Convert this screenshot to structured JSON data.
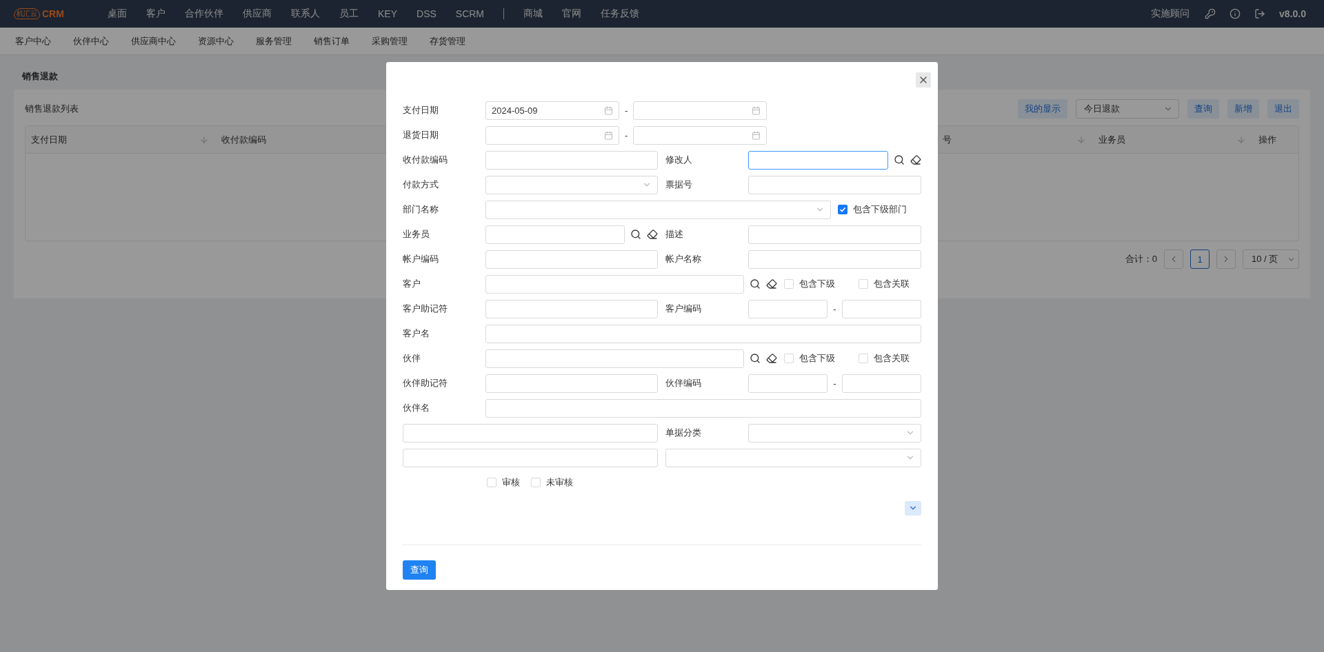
{
  "topbar": {
    "logo": {
      "badge": "机汇云",
      "name": "CRM"
    },
    "nav": [
      "桌面",
      "客户",
      "合作伙伴",
      "供应商",
      "联系人",
      "员工",
      "KEY",
      "DSS",
      "SCRM"
    ],
    "nav_extra": [
      "商城",
      "官网",
      "任务反馈"
    ],
    "role": "实施顾问",
    "version": "v8.0.0"
  },
  "subnav": [
    "客户中心",
    "伙伴中心",
    "供应商中心",
    "资源中心",
    "服务管理",
    "销售订单",
    "采购管理",
    "存货管理"
  ],
  "page": {
    "title": "销售退款",
    "card_title": "销售退款列表",
    "toolbar": {
      "display_button": "我的显示",
      "filter": "今日退款",
      "buttons": [
        "查询",
        "新增",
        "退出"
      ]
    },
    "columns": [
      {
        "label": "支付日期",
        "sortable": true
      },
      {
        "label": "收付款编码",
        "sortable": false
      },
      {
        "label": "号",
        "sortable": true
      },
      {
        "label": "业务员",
        "sortable": true
      },
      {
        "label": "操作",
        "sortable": false
      }
    ],
    "pagination": {
      "total_label": "合计：",
      "total": "0",
      "pages": [
        {
          "label": "1",
          "selected": true
        }
      ],
      "page_size": "10 / 页"
    }
  },
  "dialog": {
    "rows": [
      {
        "kind": "dates",
        "label": "支付日期",
        "value": "2024-05-09",
        "dash": "-"
      },
      {
        "kind": "dates",
        "label": "退货日期",
        "dash": "-"
      },
      {
        "kind": "pair",
        "cells": [
          {
            "label": "收付款编码",
            "kind": "text"
          },
          {
            "label": "修改人",
            "kind": "lookup",
            "focused": true
          }
        ]
      },
      {
        "kind": "pair",
        "cells": [
          {
            "label": "付款方式",
            "kind": "select"
          },
          {
            "label": "票据号",
            "kind": "text"
          }
        ]
      },
      {
        "kind": "dept",
        "label": "部门名称",
        "checkboxes": [
          {
            "label": "包含下级部门",
            "checked": true
          }
        ]
      },
      {
        "kind": "pair",
        "cells": [
          {
            "label": "业务员",
            "kind": "lookup",
            "focused": false
          },
          {
            "label": "描述",
            "kind": "text"
          }
        ]
      },
      {
        "kind": "pair",
        "cells": [
          {
            "label": "帐户编码",
            "kind": "text"
          },
          {
            "label": "帐户名称",
            "kind": "text"
          }
        ]
      },
      {
        "kind": "party",
        "label": "客户",
        "checkboxes": [
          {
            "label": "包含下级",
            "checked": false
          },
          {
            "label": "包含关联",
            "checked": false
          }
        ]
      },
      {
        "kind": "pair",
        "cells": [
          {
            "label": "客户助记符",
            "kind": "text"
          },
          {
            "label": "客户编码",
            "kind": "range",
            "dash": "-"
          }
        ]
      },
      {
        "kind": "full",
        "label": "客户名"
      },
      {
        "kind": "party",
        "label": "伙伴",
        "checkboxes": [
          {
            "label": "包含下级",
            "checked": false
          },
          {
            "label": "包含关联",
            "checked": false
          }
        ]
      },
      {
        "kind": "pair",
        "cells": [
          {
            "label": "伙伴助记符",
            "kind": "text"
          },
          {
            "label": "伙伴编码",
            "kind": "range",
            "dash": "-"
          }
        ]
      },
      {
        "kind": "full",
        "label": "伙伴名"
      },
      {
        "kind": "pair",
        "cells": [
          {
            "kind": "text"
          },
          {
            "label": "单据分类",
            "kind": "select"
          }
        ]
      },
      {
        "kind": "pair",
        "cells": [
          {
            "kind": "text"
          },
          {
            "kind": "select"
          }
        ]
      },
      {
        "kind": "checks",
        "checkboxes": [
          {
            "label": "审核",
            "checked": false
          },
          {
            "label": "未审核",
            "checked": false
          }
        ]
      }
    ],
    "submit": "查询"
  }
}
